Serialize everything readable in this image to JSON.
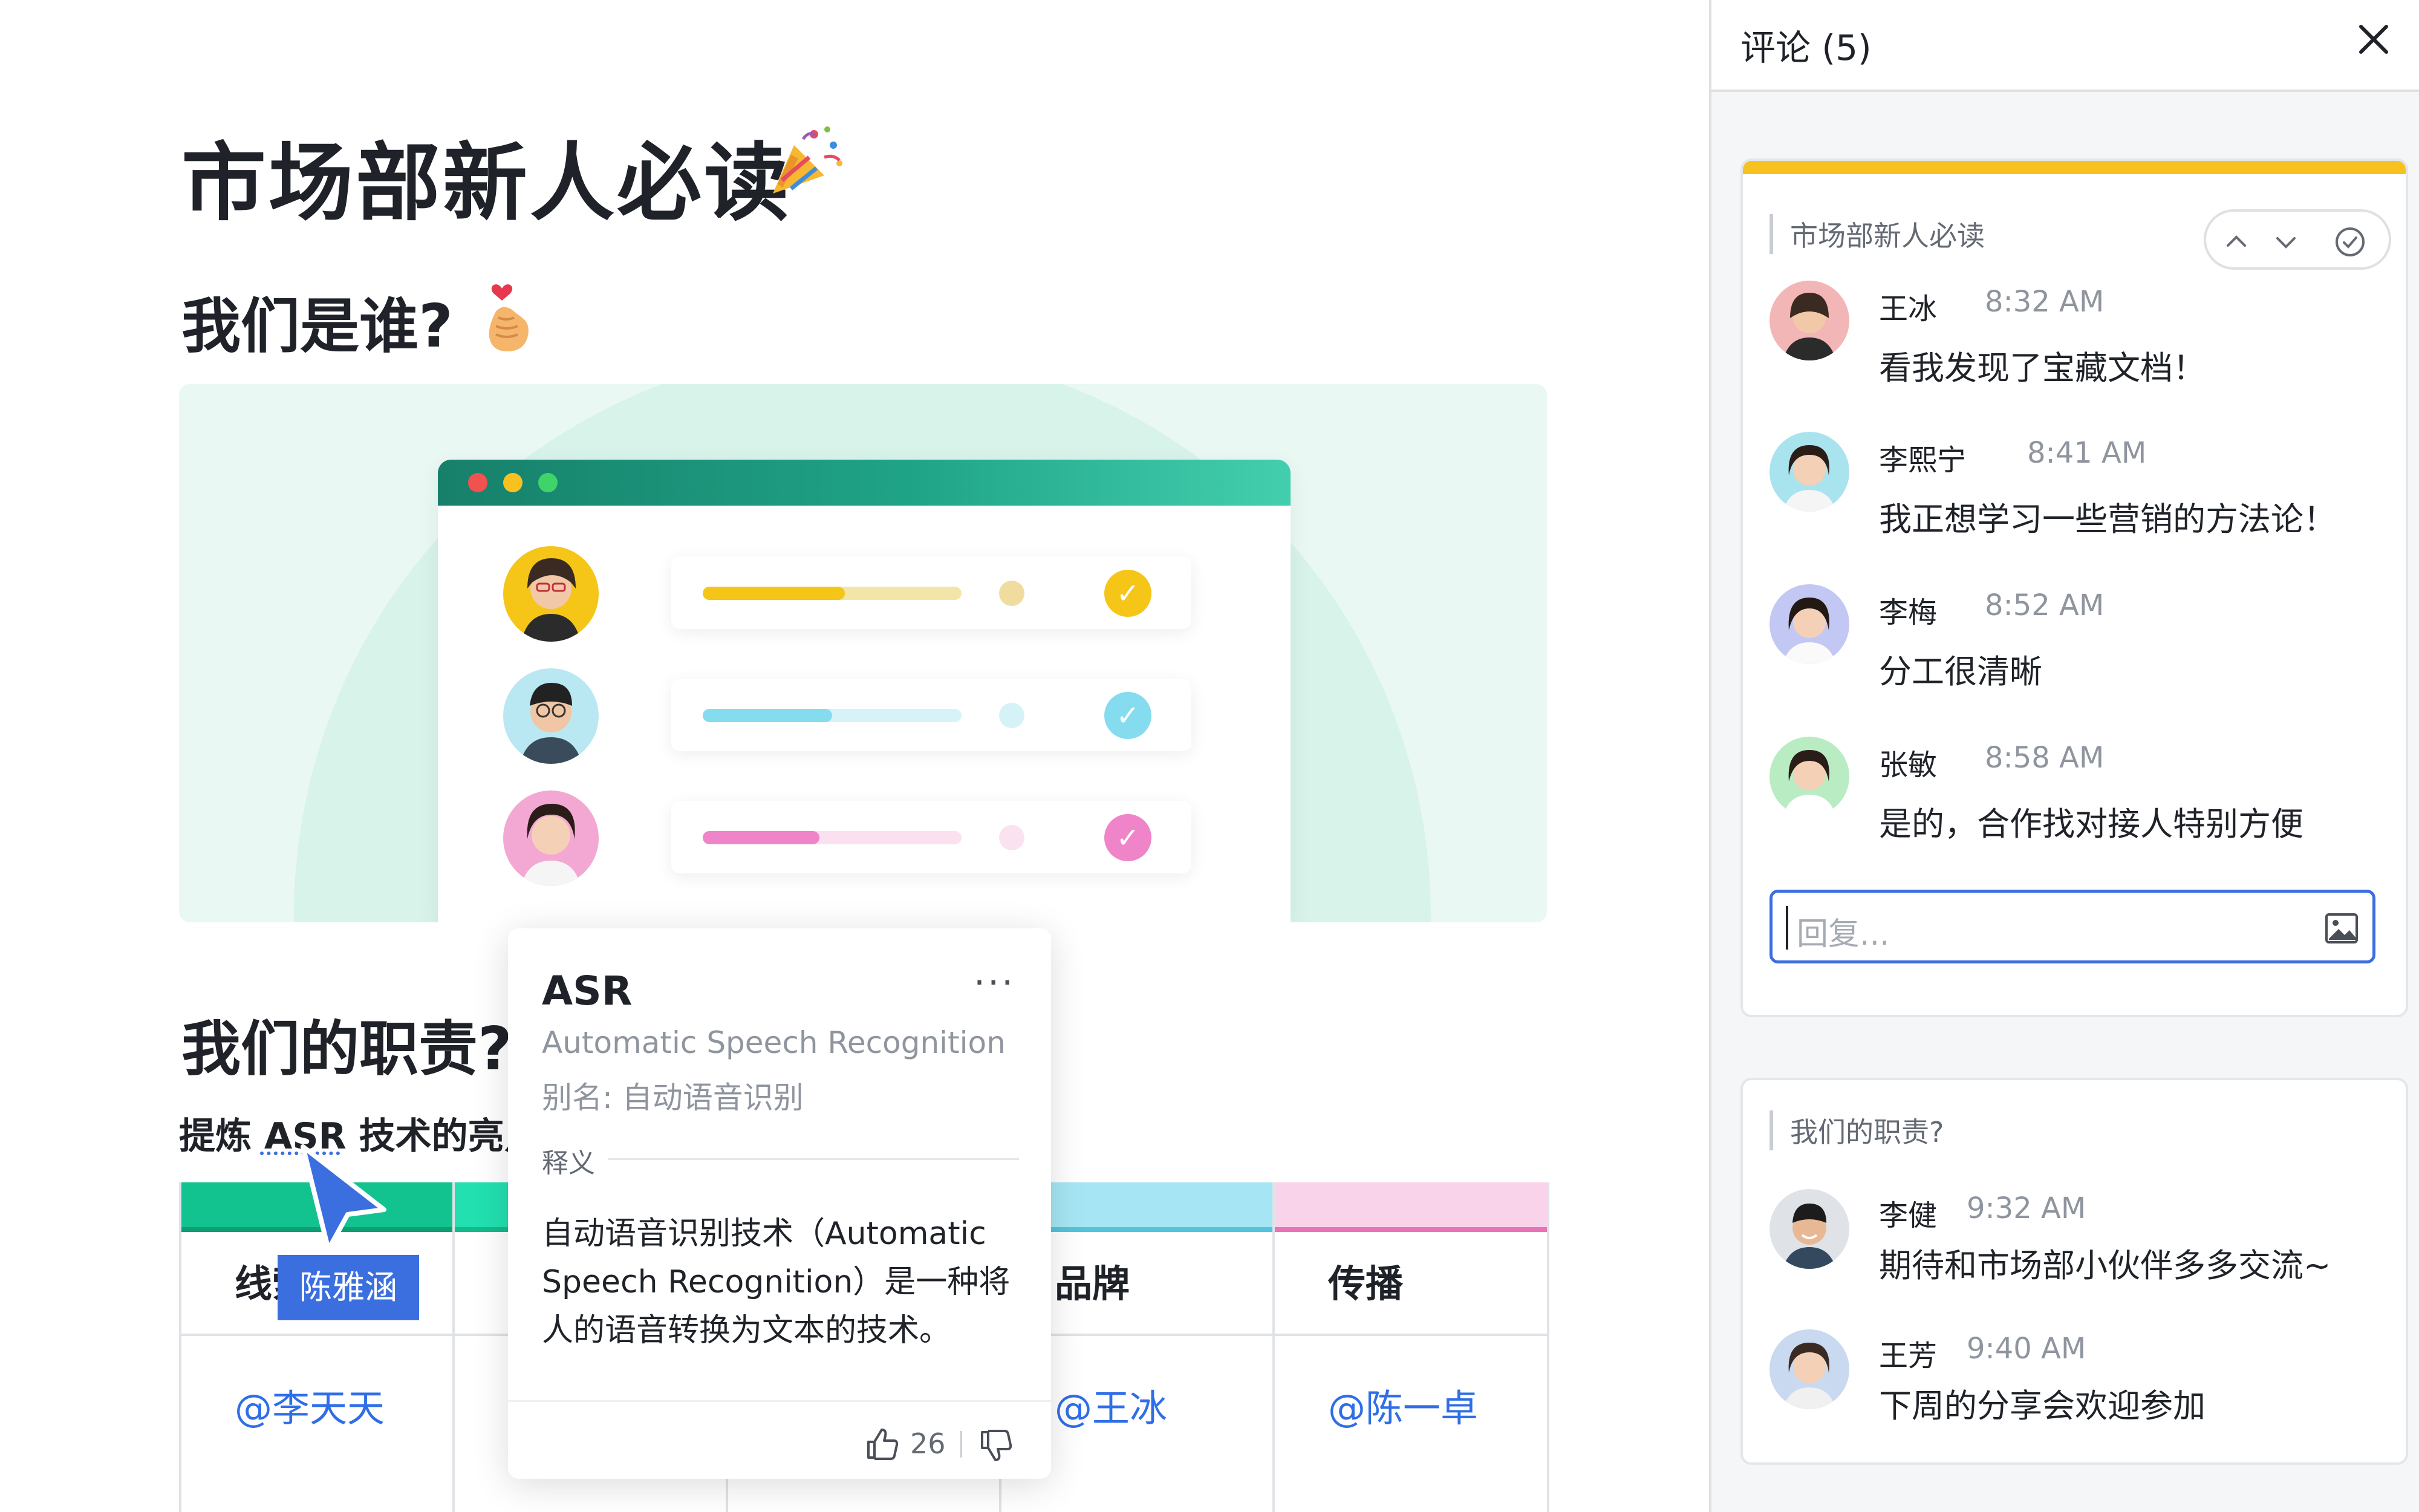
{
  "document": {
    "title": "市场部新人必读",
    "section1_heading": "我们是谁?",
    "section2_heading": "我们的职责?",
    "subtext": "提炼 ASR 技术的亮点",
    "table": {
      "columns": [
        {
          "header": "线索",
          "value": "@李天天",
          "band_color": "#12c28f",
          "rule_color": "#0f9e72"
        },
        {
          "header": "",
          "value": "",
          "band_color": "#22e0b0",
          "rule_color": "#15b98c"
        },
        {
          "header": "",
          "value": "",
          "band_color": "#c5eef6",
          "rule_color": "#7ccfe6"
        },
        {
          "header": "品牌",
          "value": "@王冰",
          "band_color": "#a6e6f4",
          "rule_color": "#55c3dd"
        },
        {
          "header": "传播",
          "value": "@陈一卓",
          "band_color": "#f9d3ea",
          "rule_color": "#e873b6"
        }
      ]
    },
    "collaborator_cursor": {
      "name": "陈雅涵",
      "color": "#3b6fe0"
    }
  },
  "hero": {
    "rows": [
      {
        "color": "#f5c518",
        "track": "#f3e5a8",
        "progress": 0.55,
        "dot": "#f1dca0"
      },
      {
        "color": "#86dcef",
        "track": "#d7f3f9",
        "progress": 0.5,
        "dot": "#d6f2f9"
      },
      {
        "color": "#f084c8",
        "track": "#fbe0f0",
        "progress": 0.45,
        "dot": "#fbe2f1"
      }
    ]
  },
  "popup": {
    "term": "ASR",
    "more": "···",
    "full_name": "Automatic Speech Recognition",
    "alias": "别名: 自动语音识别",
    "section_label": "释义",
    "definition": "自动语音识别技术（Automatic Speech Recognition）是一种将人的语音转换为文本的技术。",
    "likes": "26"
  },
  "comments_panel": {
    "title": "评论 (5)",
    "threads": [
      {
        "quote": "市场部新人必读",
        "comments": [
          {
            "name": "王冰",
            "time": "8:32 AM",
            "text": "看我发现了宝藏文档！",
            "avatar_bg": "#f3b6b6"
          },
          {
            "name": "李熙宁",
            "time": "8:41 AM",
            "text": "我正想学习一些营销的方法论！",
            "avatar_bg": "#a9e3ee"
          },
          {
            "name": "李梅",
            "time": "8:52 AM",
            "text": "分工很清晰",
            "avatar_bg": "#c3c7f3"
          },
          {
            "name": "张敏",
            "time": "8:58 AM",
            "text": "是的，合作找对接人特别方便",
            "avatar_bg": "#b9ecc2"
          }
        ],
        "reply_placeholder": "回复..."
      },
      {
        "quote": "我们的职责?",
        "comments": [
          {
            "name": "李健",
            "time": "9:32 AM",
            "text": "期待和市场部小伙伴多多交流~",
            "avatar_bg": "#dfe3e8"
          },
          {
            "name": "王芳",
            "time": "9:40 AM",
            "text": "下周的分享会欢迎参加",
            "avatar_bg": "#c8d9f0"
          }
        ]
      }
    ]
  },
  "colors": {
    "accent_blue": "#3b6fe0",
    "accent_yellow": "#f7c21f",
    "brand_green": "#1fa387"
  }
}
